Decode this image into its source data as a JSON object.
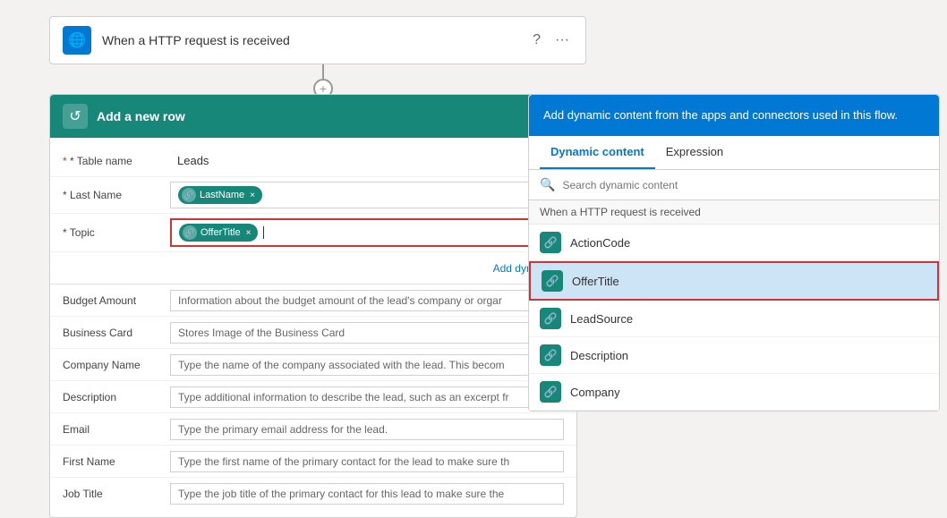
{
  "http_card": {
    "title": "When a HTTP request is received",
    "icon": "🌐"
  },
  "connector": {
    "plus": "+"
  },
  "main_card": {
    "header_title": "Add a new row",
    "header_icon": "↺",
    "fields": {
      "table_name_label": "* Table name",
      "table_name_value": "Leads",
      "last_name_label": "* Last Name",
      "last_name_token": "LastName",
      "topic_label": "* Topic",
      "topic_token": "OfferTitle",
      "add_dynamic_label": "Add dynamic...",
      "budget_amount_label": "Budget Amount",
      "budget_amount_value": "Information about the budget amount of the lead's company or orgar",
      "business_card_label": "Business Card",
      "business_card_value": "Stores Image of the Business Card",
      "company_name_label": "Company Name",
      "company_name_value": "Type the name of the company associated with the lead. This becom",
      "description_label": "Description",
      "description_value": "Type additional information to describe the lead, such as an excerpt fr",
      "email_label": "Email",
      "email_value": "Type the primary email address for the lead.",
      "first_name_label": "First Name",
      "first_name_value": "Type the first name of the primary contact for the lead to make sure th",
      "job_title_label": "Job Title",
      "job_title_value": "Type the job title of the primary contact for this lead to make sure the"
    }
  },
  "right_panel": {
    "header_text": "Add dynamic content from the apps and connectors used in this flow.",
    "tab_dynamic": "Dynamic content",
    "tab_expression": "Expression",
    "search_placeholder": "Search dynamic content",
    "section_header": "When a HTTP request is received",
    "items": [
      {
        "label": "ActionCode",
        "highlighted": false
      },
      {
        "label": "OfferTitle",
        "highlighted": true
      },
      {
        "label": "LeadSource",
        "highlighted": false
      },
      {
        "label": "Description",
        "highlighted": false
      },
      {
        "label": "Company",
        "highlighted": false
      }
    ]
  },
  "colors": {
    "teal": "#17877a",
    "blue": "#0078d4",
    "red": "#d13438"
  }
}
